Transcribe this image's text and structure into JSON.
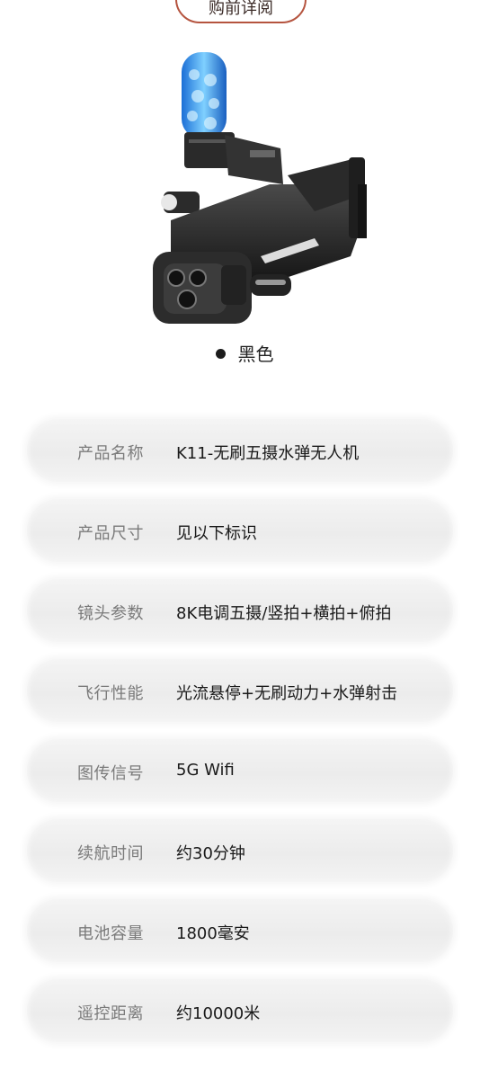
{
  "header": {
    "button_label": "购前详阅"
  },
  "product": {
    "image_name": "water-bullet-drone",
    "color_label": "黑色"
  },
  "specs": [
    {
      "label": "产品名称",
      "value": "K11-无刷五摄水弹无人机"
    },
    {
      "label": "产品尺寸",
      "value": "见以下标识"
    },
    {
      "label": "镜头参数",
      "value": "8K电调五摄/竖拍+横拍+俯拍"
    },
    {
      "label": "飞行性能",
      "value": "光流悬停+无刷动力+水弹射击"
    },
    {
      "label": "图传信号",
      "value": "5G Wifi"
    },
    {
      "label": "续航时间",
      "value": "约30分钟"
    },
    {
      "label": "电池容量",
      "value": "1800毫安"
    },
    {
      "label": "遥控距离",
      "value": "约10000米"
    }
  ],
  "colors": {
    "pill_border": "#b5543f",
    "row_bg": "#ececec",
    "label": "#7a7a7a",
    "value": "#1a1a1a"
  }
}
